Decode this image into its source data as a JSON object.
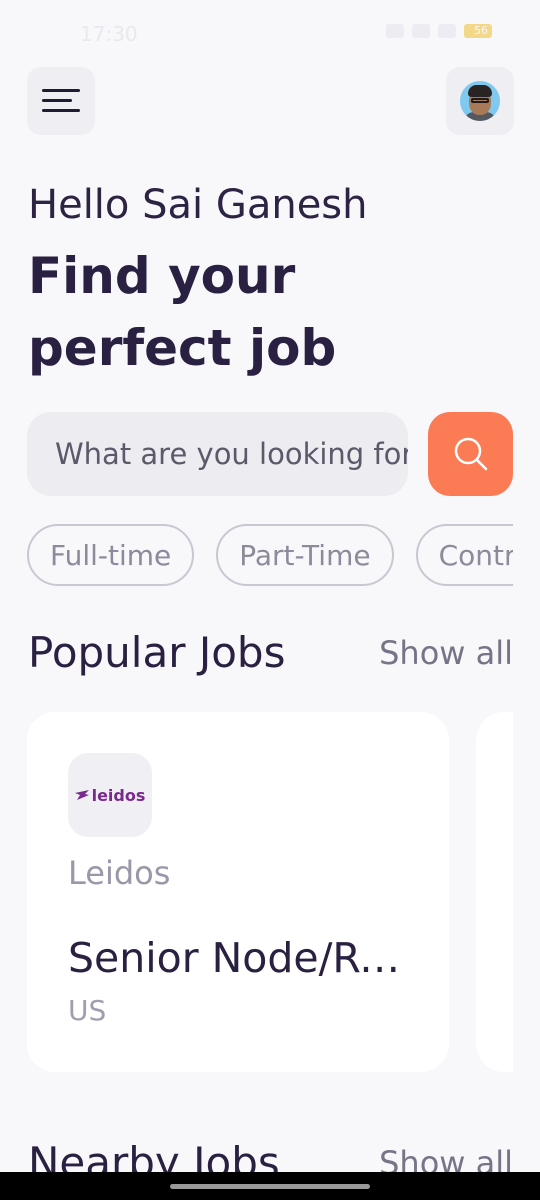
{
  "status_bar": {
    "time": "17:30",
    "battery": "56"
  },
  "header": {
    "menu_icon": "hamburger-menu-icon",
    "avatar_icon": "user-avatar"
  },
  "greeting": "Hello Sai Ganesh",
  "headline": "Find your perfect job",
  "search": {
    "placeholder": "What are you looking for?",
    "button_icon": "search-icon"
  },
  "filters": [
    "Full-time",
    "Part-Time",
    "Contract"
  ],
  "popular_jobs": {
    "title": "Popular Jobs",
    "show_all": "Show all",
    "jobs": [
      {
        "logo_text": "leidos",
        "company": "Leidos",
        "title": "Senior Node/React Developer",
        "location": "US"
      }
    ]
  },
  "nearby_jobs": {
    "title": "Nearby Jobs",
    "show_all": "Show all"
  },
  "colors": {
    "accent": "#fb7b55",
    "text_dark": "#2a2041",
    "background": "#f8f8fb",
    "logo_purple": "#7a2a8c"
  }
}
